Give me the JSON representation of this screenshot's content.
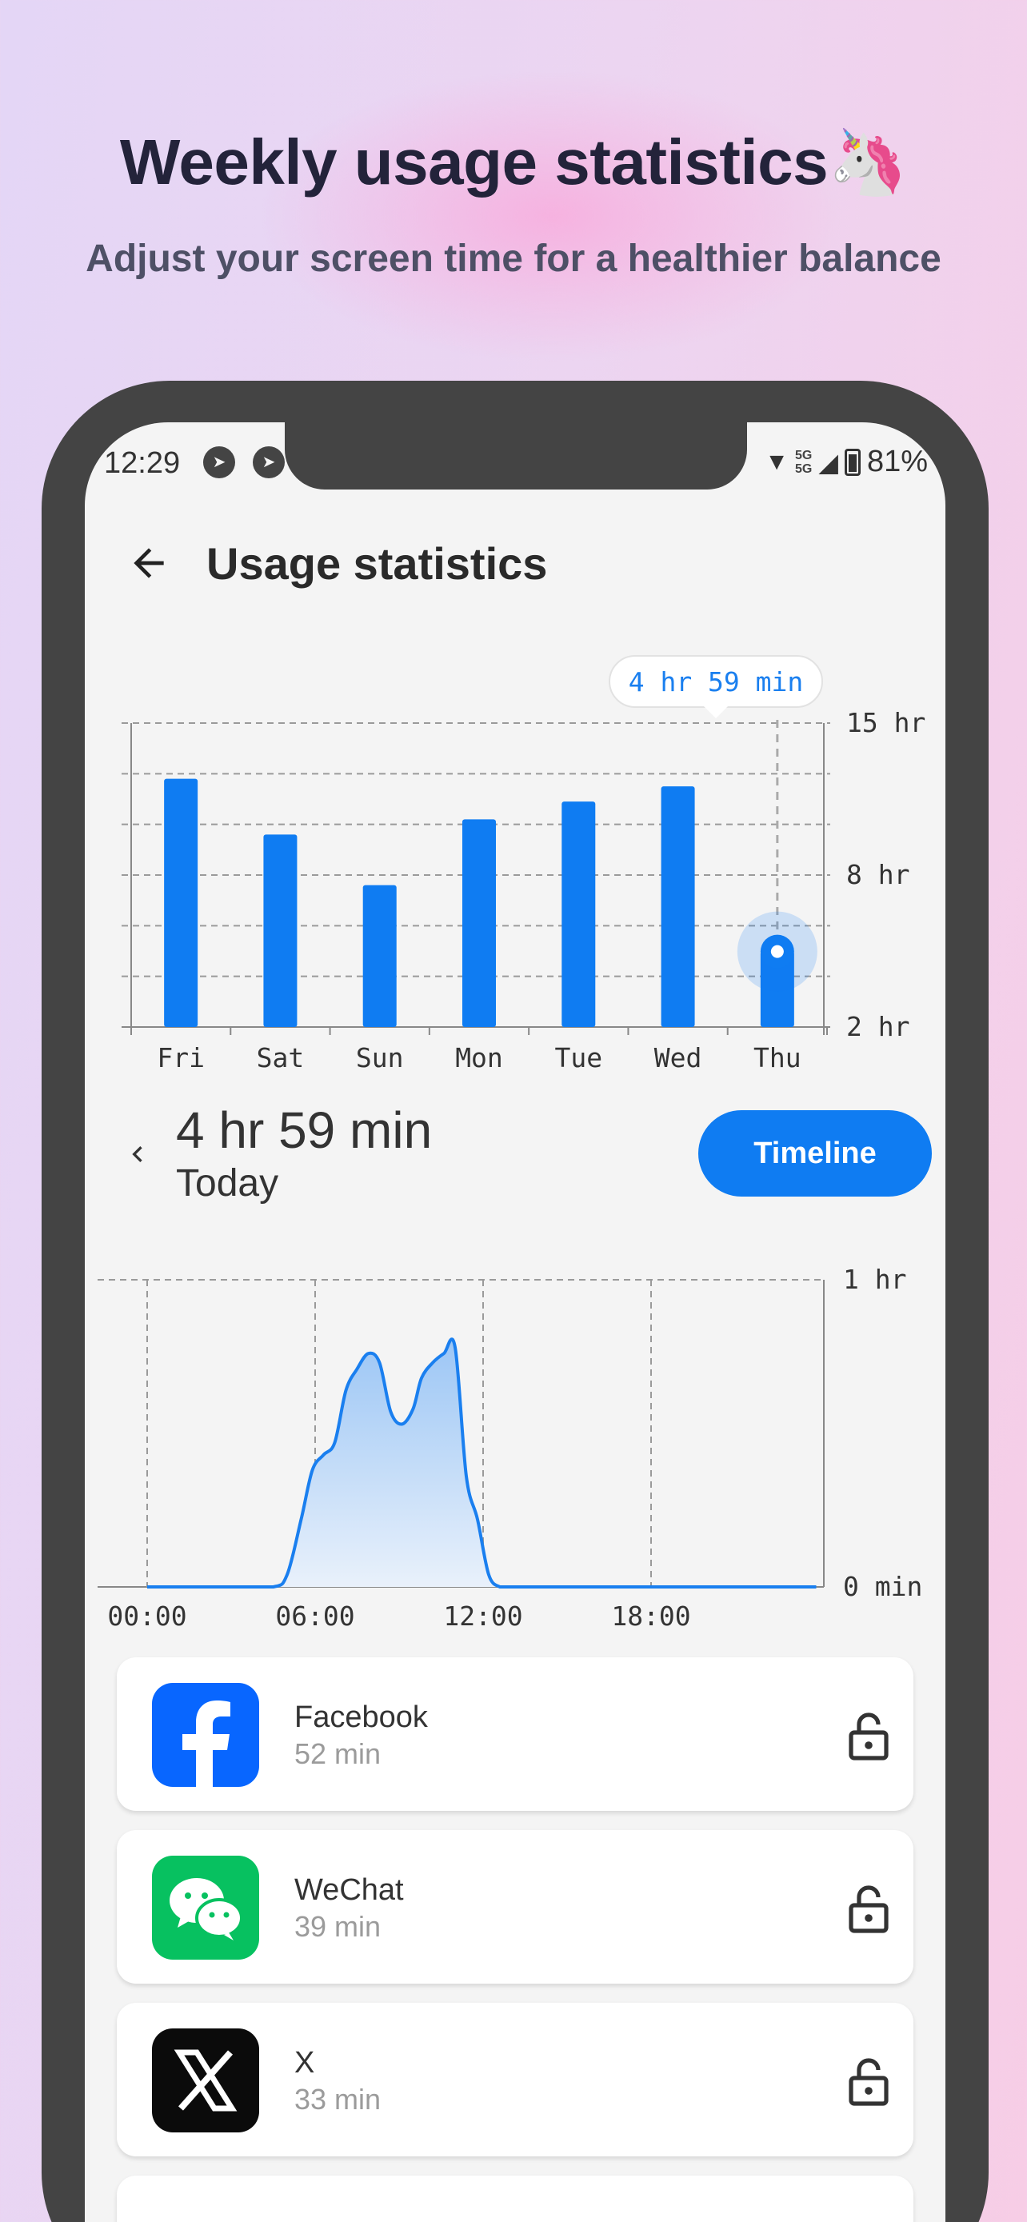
{
  "promo": {
    "title": "Weekly usage statistics🦄",
    "subtitle": "Adjust your screen time for a healthier balance"
  },
  "status_bar": {
    "time": "12:29",
    "left_icons": [
      "telegram-icon",
      "telegram-icon"
    ],
    "network_1": "5G",
    "network_2": "5G",
    "battery": "81%"
  },
  "appbar": {
    "back_icon": "arrow-left-icon",
    "title": "Usage statistics"
  },
  "weekly_chart": {
    "tooltip": "4 hr 59 min",
    "selected_day": "Thu"
  },
  "chart_data": [
    {
      "type": "bar",
      "categories": [
        "Fri",
        "Sat",
        "Sun",
        "Mon",
        "Tue",
        "Wed",
        "Thu"
      ],
      "values": [
        11.8,
        9.6,
        7.6,
        10.2,
        10.9,
        11.5,
        4.98
      ],
      "y_tick_labels": [
        "2 hr",
        "8 hr",
        "15 hr"
      ],
      "y_tick_values": [
        2,
        8,
        14
      ],
      "ylim": [
        2,
        14
      ],
      "grid": true,
      "highlighted_category": "Thu",
      "annotation": "4 hr 59 min"
    },
    {
      "type": "area",
      "x": [
        0,
        3,
        4.5,
        5,
        5.5,
        5.9,
        6.3,
        6.7,
        7.1,
        7.5,
        7.9,
        8.3,
        8.7,
        9.1,
        9.5,
        9.8,
        10.2,
        10.6,
        11,
        11.4,
        11.8,
        12.2,
        12.6,
        13,
        15,
        18,
        21,
        23.9
      ],
      "y": [
        0,
        0,
        0,
        0.04,
        0.22,
        0.38,
        0.43,
        0.47,
        0.64,
        0.71,
        0.76,
        0.73,
        0.57,
        0.53,
        0.58,
        0.68,
        0.73,
        0.76,
        0.78,
        0.36,
        0.22,
        0.04,
        0,
        0,
        0,
        0,
        0,
        0
      ],
      "x_tick_labels": [
        "00:00",
        "06:00",
        "12:00",
        "18:00"
      ],
      "y_tick_labels": [
        "0 min",
        "1 hr"
      ],
      "ylim": [
        0,
        1
      ],
      "grid": true
    }
  ],
  "day_summary": {
    "prev_icon": "chevron-left-icon",
    "total": "4 hr 59 min",
    "label": "Today",
    "timeline_button": "Timeline"
  },
  "apps": [
    {
      "name": "Facebook",
      "time": "52 min",
      "icon": "facebook-icon",
      "color": "#0866ff"
    },
    {
      "name": "WeChat",
      "time": "39 min",
      "icon": "wechat-icon",
      "color": "#07c160"
    },
    {
      "name": "X",
      "time": "33 min",
      "icon": "x-icon",
      "color": "#000000"
    }
  ]
}
